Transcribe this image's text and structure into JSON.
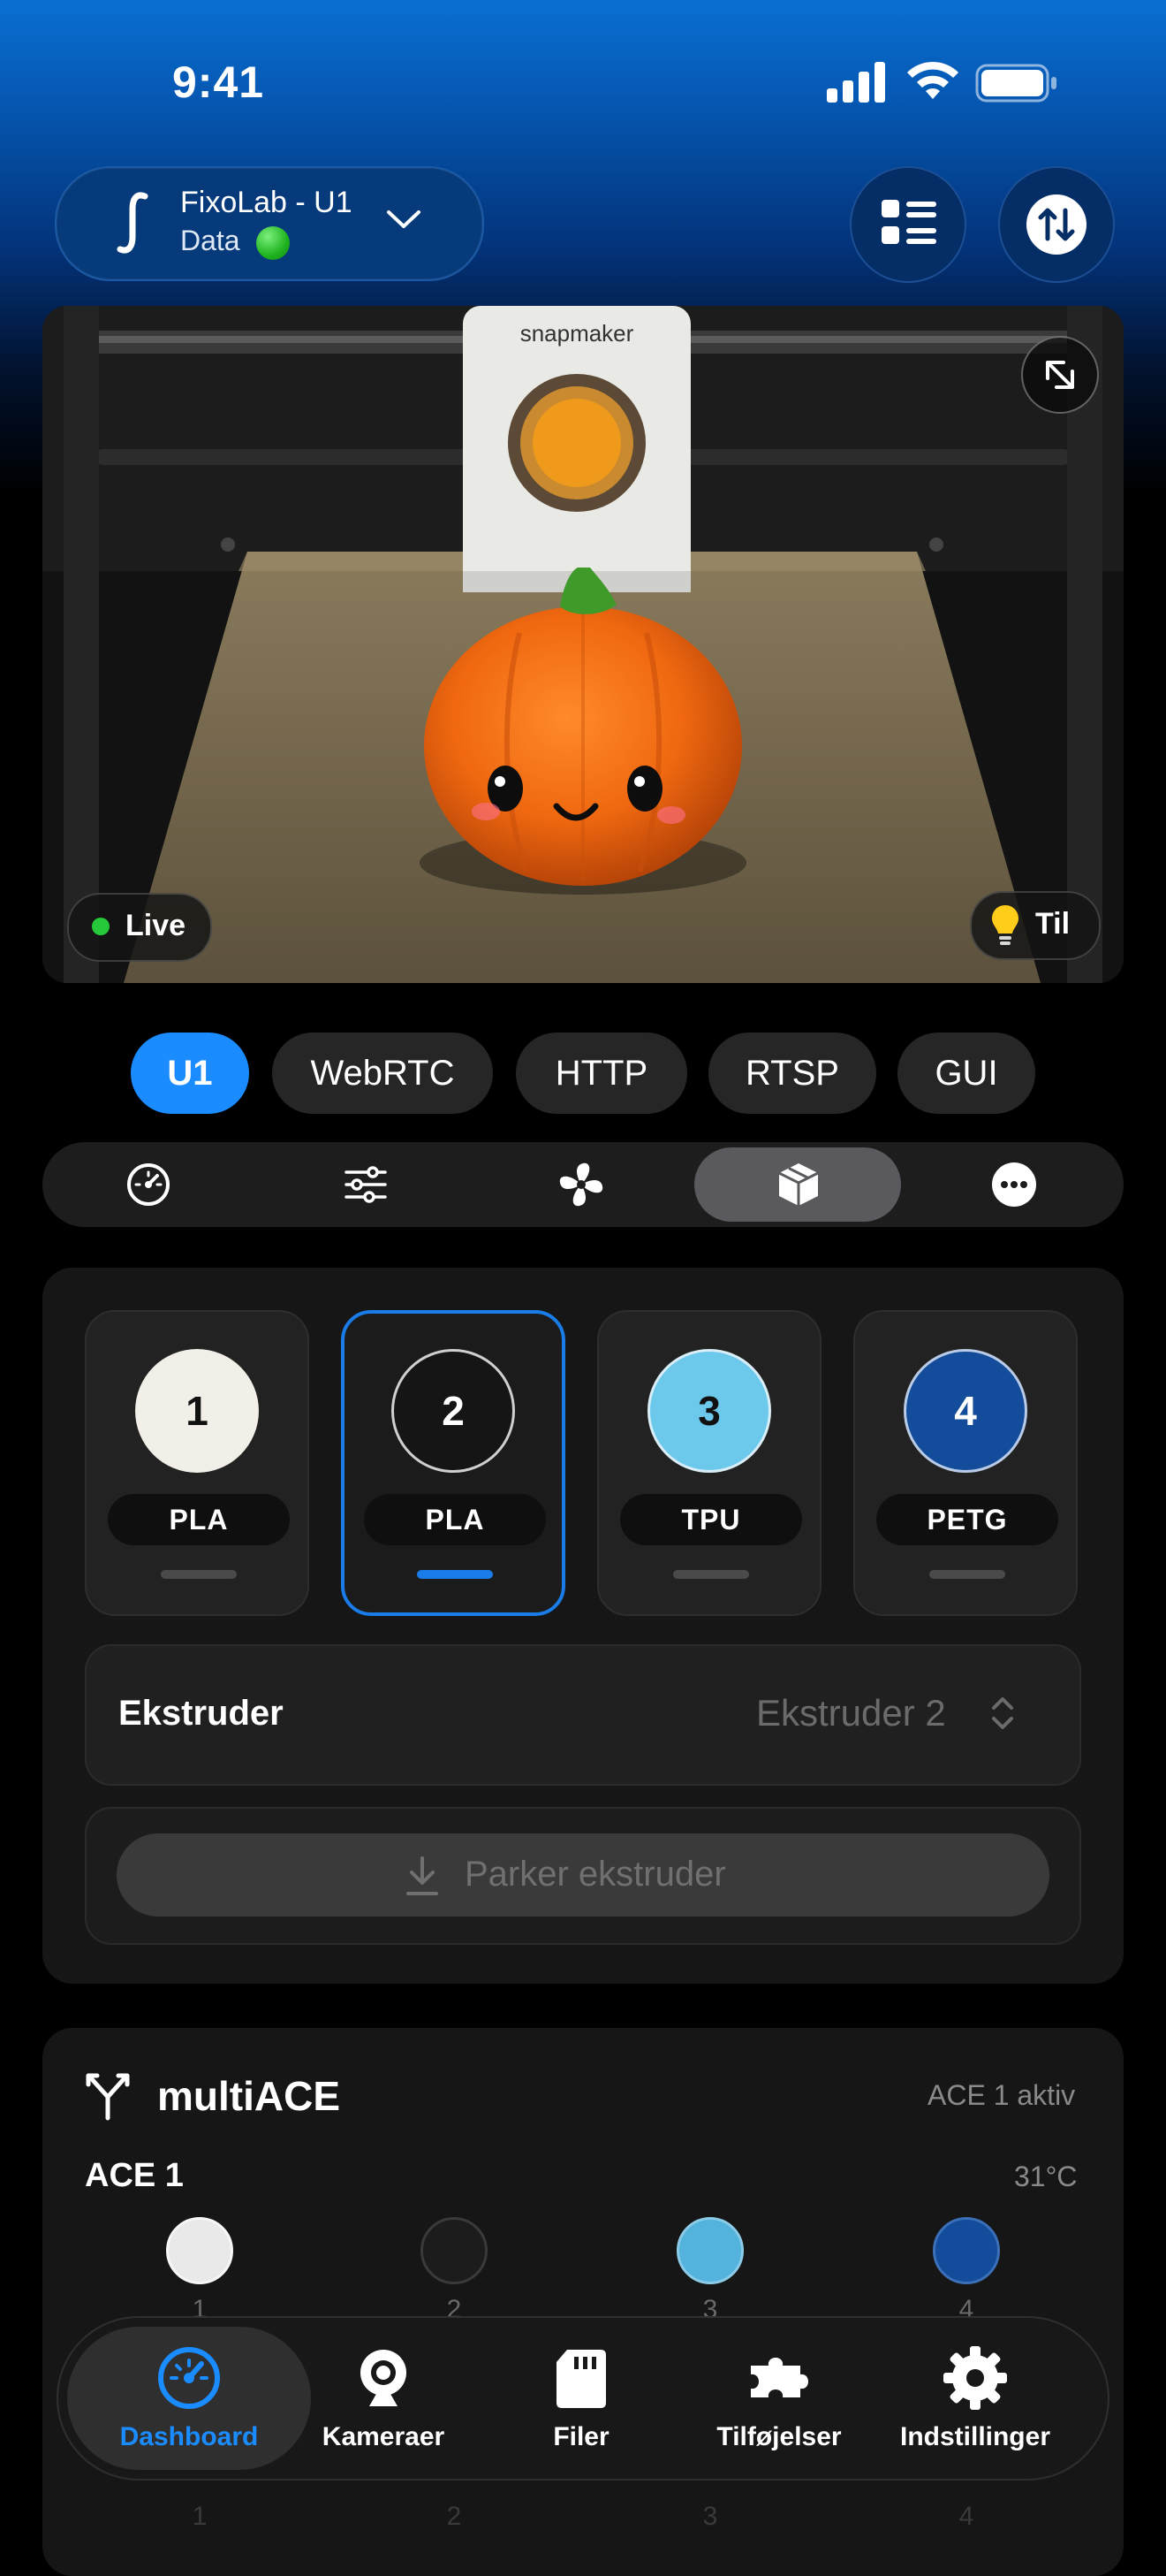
{
  "status_bar": {
    "time": "9:41"
  },
  "header": {
    "printer_name": "FixoLab - U1",
    "printer_sub": "Data",
    "icons": [
      "list-icon",
      "swap-arrows-icon"
    ]
  },
  "camera": {
    "live_label": "Live",
    "light_label": "Til"
  },
  "stream_tabs": [
    "U1",
    "WebRTC",
    "HTTP",
    "RTSP",
    "GUI"
  ],
  "stream_tab_selected": "U1",
  "segments": [
    "gauge-icon",
    "sliders-icon",
    "fan-icon",
    "box-icon",
    "more-icon"
  ],
  "segment_selected": "box-icon",
  "extruders": {
    "slots": [
      {
        "number": "1",
        "material": "PLA",
        "color": "#f2efe8",
        "text_color": "#111111"
      },
      {
        "number": "2",
        "material": "PLA",
        "color": "#151515",
        "text_color": "#ffffff"
      },
      {
        "number": "3",
        "material": "TPU",
        "color": "#6cc9ec",
        "text_color": "#111111"
      },
      {
        "number": "4",
        "material": "PETG",
        "color": "#124c9a",
        "text_color": "#ffffff"
      }
    ],
    "selected_slot": "2",
    "extruder_label": "Ekstruder",
    "extruder_value": "Ekstruder 2",
    "park_label": "Parker ekstruder"
  },
  "multiace": {
    "title": "multiACE",
    "status": "ACE 1 aktiv",
    "unit_name": "ACE 1",
    "temperature": "31°C",
    "slots": [
      {
        "number": "1",
        "color": "#e9e9e9"
      },
      {
        "number": "2",
        "color": "#1c1c1c"
      },
      {
        "number": "3",
        "color": "#54b3dd"
      },
      {
        "number": "4",
        "color": "#124c9a"
      }
    ]
  },
  "tabbar": {
    "items": [
      {
        "label": "Dashboard",
        "icon": "gauge-icon"
      },
      {
        "label": "Kameraer",
        "icon": "webcam-icon"
      },
      {
        "label": "Filer",
        "icon": "sd-card-icon"
      },
      {
        "label": "Tilføjelser",
        "icon": "puzzle-icon"
      },
      {
        "label": "Indstillinger",
        "icon": "gear-icon"
      }
    ],
    "selected": "Dashboard"
  },
  "colors": {
    "accent": "#1a8cff",
    "header_blue": "#0a6fd2",
    "selected_border": "#1a7ce8"
  }
}
